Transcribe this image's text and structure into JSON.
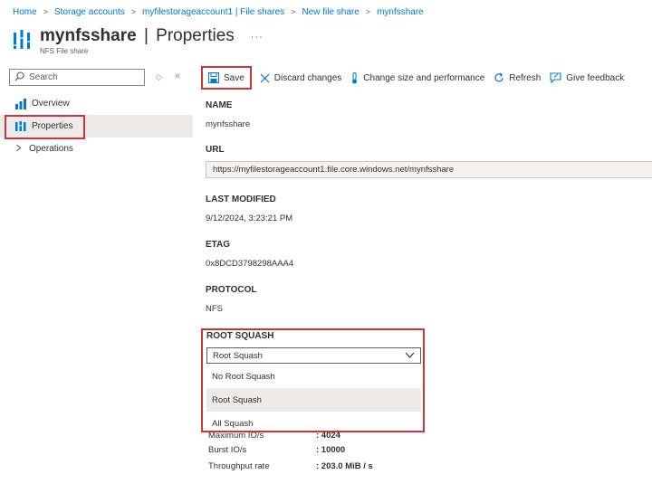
{
  "breadcrumb": [
    "Home",
    "Storage accounts",
    "myfilestorageaccount1 | File shares",
    "New file share",
    "mynfsshare"
  ],
  "header": {
    "resource_name": "mynfsshare",
    "pipe": "|",
    "blade_title": "Properties",
    "subtitle": "NFS File share",
    "more": "···",
    "icon": "file-share-icon"
  },
  "sidebar": {
    "search_placeholder": "Search",
    "collapse_icons": [
      "◇",
      "«"
    ],
    "items": [
      {
        "label": "Overview",
        "icon": "overview-icon"
      },
      {
        "label": "Properties",
        "icon": "properties-icon",
        "selected": true
      },
      {
        "label": "Operations",
        "icon": "chevron-right-icon"
      }
    ]
  },
  "toolbar": {
    "save": "Save",
    "discard": "Discard changes",
    "change_size": "Change size and performance",
    "refresh": "Refresh",
    "feedback": "Give feedback"
  },
  "properties": {
    "name_label": "NAME",
    "name_value": "mynfsshare",
    "url_label": "URL",
    "url_value": "https://myfilestorageaccount1.file.core.windows.net/mynfsshare",
    "modified_label": "LAST MODIFIED",
    "modified_value": "9/12/2024, 3:23:21 PM",
    "etag_label": "ETAG",
    "etag_value": "0x8DCD3798298AAA4",
    "protocol_label": "PROTOCOL",
    "protocol_value": "NFS"
  },
  "root_squash": {
    "label": "ROOT SQUASH",
    "selected": "Root Squash",
    "options": [
      "No Root Squash",
      "Root Squash",
      "All Squash"
    ]
  },
  "performance": [
    {
      "label": "Maximum IO/s",
      "value": ": 4024"
    },
    {
      "label": "Burst IO/s",
      "value": ": 10000"
    },
    {
      "label": "Throughput rate",
      "value": ": 203.0 MiB / s"
    }
  ],
  "colors": {
    "accent": "#0078d4",
    "highlight_outline": "#d13438",
    "selected_bg": "#edebe9"
  }
}
